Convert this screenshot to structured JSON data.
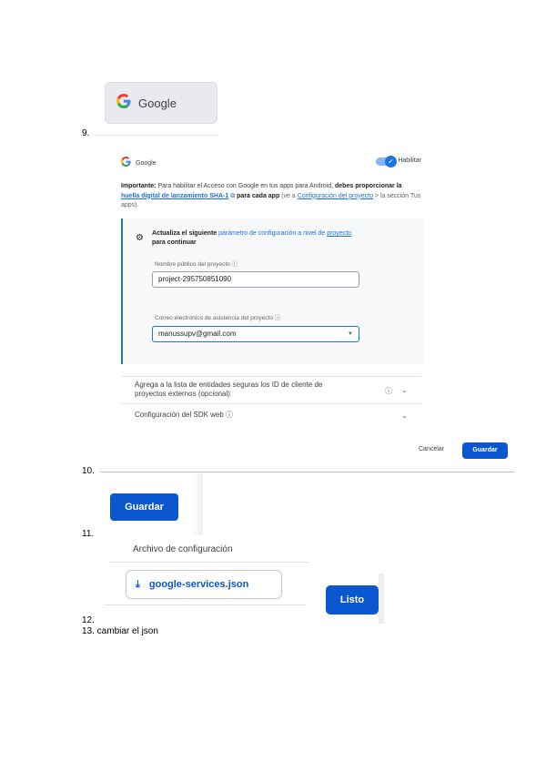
{
  "steps": {
    "s9": "9.",
    "s10": "10.",
    "s11": "11.",
    "s12": "12.",
    "s13": "13. cambiar el json"
  },
  "google_button": {
    "label": "Google"
  },
  "provider": {
    "name": "Google",
    "toggle_label": "Habilitar",
    "toggle_on": true,
    "important_bold": "Importante:",
    "important_text1": " Para habilitar el Acceso con Google en tus apps para Android, ",
    "important_bold2": "debes proporcionar la ",
    "important_link": "huella digital de lanzamiento SHA-1",
    "important_bold3": " para cada app",
    "important_dim1": " (ve a ",
    "important_link2": "Configuración del proyecto",
    "important_dim2": " > la sección Tus apps)."
  },
  "config": {
    "prefix": "Actualiza el siguiente ",
    "link": "parámetro de configuración a nivel de ",
    "link2": "proyecto",
    "suffix": " para continuar",
    "public_name_label": "Nombre público del proyecto ⓘ",
    "public_name_value": "project-295750851090",
    "email_label": "Correo electrónico de asistencia del proyecto ⓘ",
    "email_value": "manussupv@gmail.com"
  },
  "rows": {
    "whitelist": "Agrega a la lista de entidades seguras los ID de cliente de proyectos externos (opcional)",
    "sdk": "Configuración del SDK web ⓘ"
  },
  "actions": {
    "cancel": "Cancelar",
    "save": "Guardar",
    "save_big": "Guardar"
  },
  "config_file": {
    "title": "Archivo de configuración",
    "file": "google-services.json",
    "done": "Listo"
  },
  "colors": {
    "accent": "#0b57d0",
    "link": "#1a73e8"
  }
}
